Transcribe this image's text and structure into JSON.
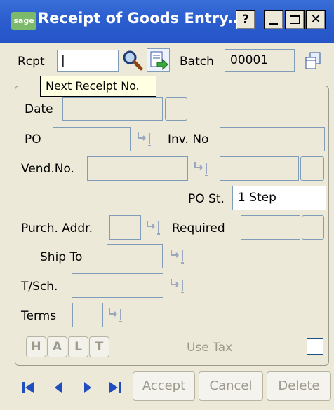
{
  "window": {
    "logo": "sage",
    "title": "Receipt of Goods Entry...",
    "help_label": "?",
    "minimize_icon": "minimize-icon",
    "maximize_icon": "maximize-icon",
    "close_icon": "close-icon"
  },
  "header": {
    "rcpt_label": "Rcpt",
    "rcpt_value": "|",
    "tooltip": "Next Receipt No.",
    "batch_label": "Batch",
    "batch_value": "00001"
  },
  "form": {
    "date_label": "Date",
    "po_label": "PO",
    "inv_no_label": "Inv. No",
    "vend_no_label": "Vend.No.",
    "po_st_label": "PO St.",
    "po_st_value": "1 Step",
    "purch_addr_label": "Purch. Addr.",
    "required_label": "Required",
    "ship_to_label": "Ship To",
    "tsch_label": "T/Sch.",
    "terms_label": "Terms",
    "halt_buttons": [
      "H",
      "A",
      "L",
      "T"
    ],
    "use_tax_label": "Use Tax"
  },
  "footer": {
    "accept_label": "Accept",
    "cancel_label": "Cancel",
    "delete_label": "Delete"
  }
}
